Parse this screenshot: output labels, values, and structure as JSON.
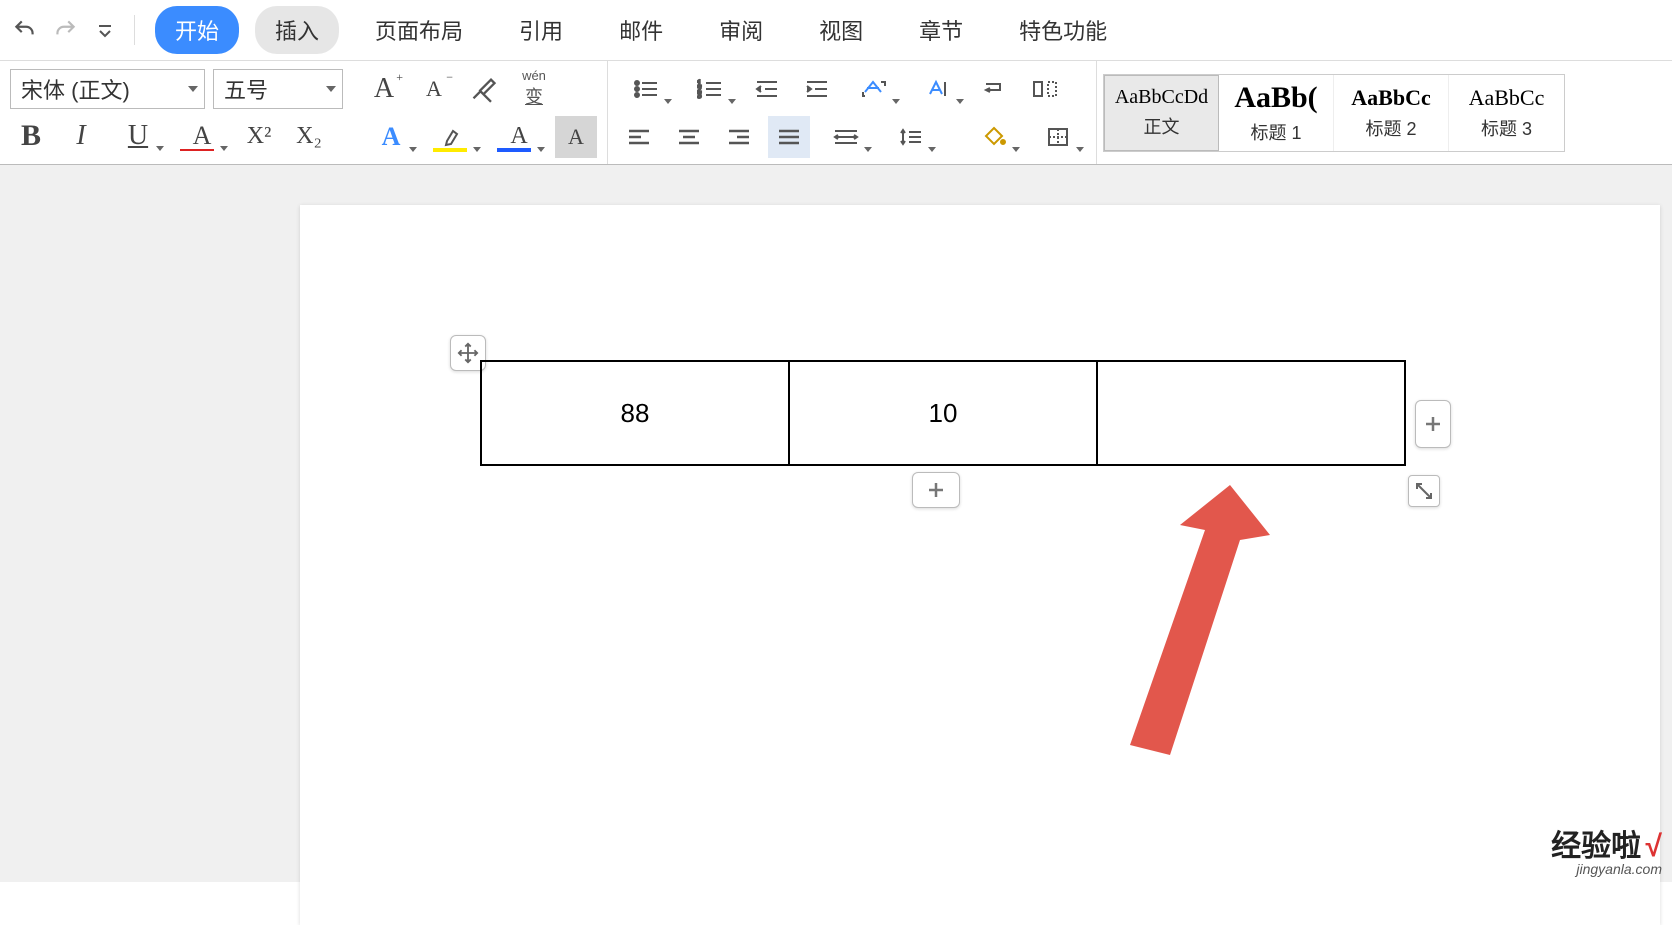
{
  "menu": {
    "tabs": [
      "开始",
      "插入",
      "页面布局",
      "引用",
      "邮件",
      "审阅",
      "视图",
      "章节",
      "特色功能"
    ],
    "active_index": 0,
    "hover_index": 1
  },
  "ribbon": {
    "font_name": "宋体 (正文)",
    "font_size": "五号",
    "wen_label": "wén",
    "wen_char": "变",
    "bold": "B",
    "italic": "I",
    "underline": "U",
    "strike": "A",
    "super": "X²",
    "sub": "X₂",
    "char_a_big": "A",
    "char_a_small": "A",
    "box_a": "A"
  },
  "styles": [
    {
      "preview": "AaBbCcDd",
      "cls": "",
      "name": "正文",
      "selected": true
    },
    {
      "preview": "AaBb(",
      "cls": "big",
      "name": "标题 1",
      "selected": false
    },
    {
      "preview": "AaBbCc",
      "cls": "med",
      "name": "标题 2",
      "selected": false
    },
    {
      "preview": "AaBbCc",
      "cls": "reg",
      "name": "标题 3",
      "selected": false
    }
  ],
  "table": {
    "cells": [
      "88",
      "10",
      ""
    ]
  },
  "watermark": {
    "main": "经验啦",
    "check": "√",
    "sub": "jingyanla.com"
  }
}
